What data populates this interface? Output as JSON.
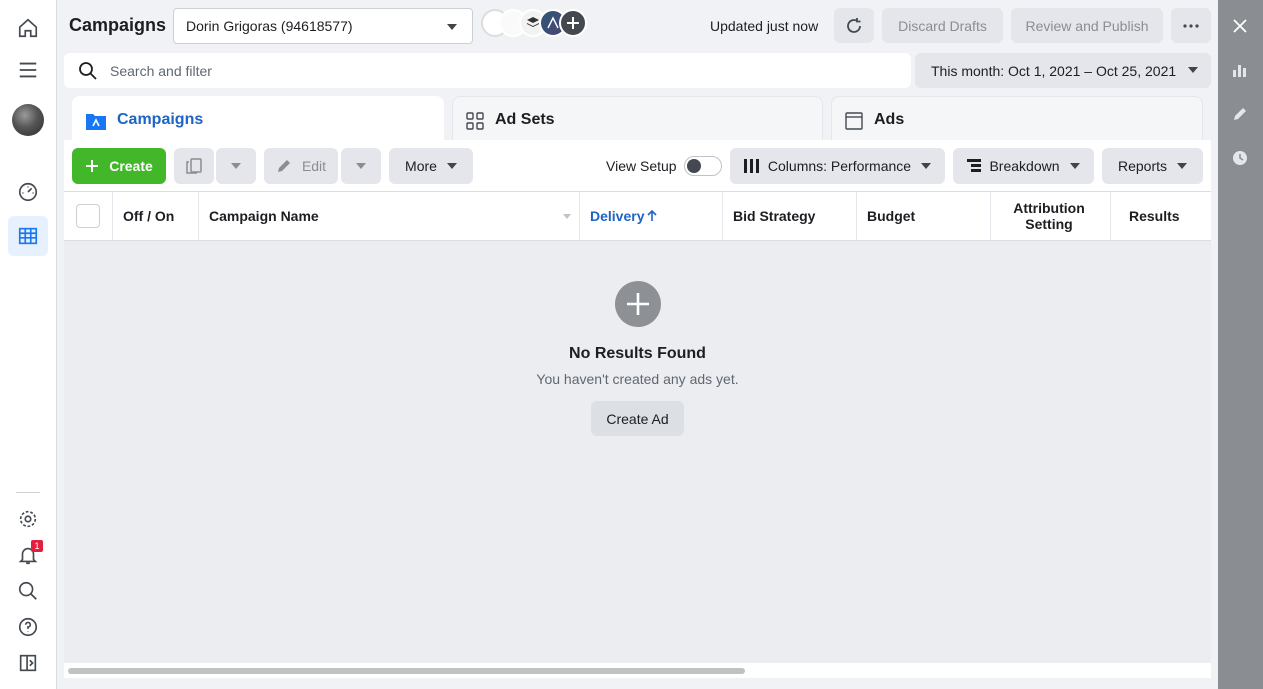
{
  "header": {
    "title": "Campaigns",
    "account": "Dorin Grigoras (94618577)",
    "updated": "Updated just now",
    "discard": "Discard Drafts",
    "review": "Review and Publish",
    "more_icon": "ellipsis-icon"
  },
  "search": {
    "placeholder": "Search and filter",
    "date_range": "This month: Oct 1, 2021 – Oct 25, 2021"
  },
  "tabs": [
    {
      "label": "Campaigns",
      "icon": "folder-icon",
      "active": true
    },
    {
      "label": "Ad Sets",
      "icon": "grid-icon",
      "active": false
    },
    {
      "label": "Ads",
      "icon": "ad-frame-icon",
      "active": false
    }
  ],
  "toolbar": {
    "create": "Create",
    "edit": "Edit",
    "more": "More",
    "view_setup": "View Setup",
    "columns": "Columns: Performance",
    "breakdown": "Breakdown",
    "reports": "Reports"
  },
  "table": {
    "columns": [
      "Off / On",
      "Campaign Name",
      "Delivery",
      "Bid Strategy",
      "Budget",
      "Attribution Setting",
      "Results"
    ],
    "sorted_column": "Delivery"
  },
  "empty_state": {
    "title": "No Results Found",
    "subtitle": "You haven't created any ads yet.",
    "button": "Create Ad"
  },
  "nav": {
    "notification_count": "1"
  },
  "colors": {
    "accent": "#1d64c7",
    "create_green": "#42b72a",
    "rail": "#8a8d91"
  }
}
